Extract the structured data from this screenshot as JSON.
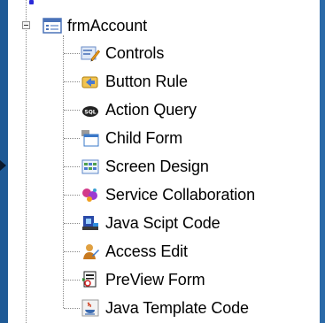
{
  "tree": {
    "root": {
      "label": "frmAccount",
      "icon": "form-window-icon"
    },
    "children": [
      {
        "label": "Controls",
        "icon": "controls-icon"
      },
      {
        "label": "Button Rule",
        "icon": "button-rule-icon"
      },
      {
        "label": "Action Query",
        "icon": "sql-query-icon"
      },
      {
        "label": "Child Form",
        "icon": "child-form-icon"
      },
      {
        "label": "Screen Design",
        "icon": "screen-design-icon"
      },
      {
        "label": "Service Collaboration",
        "icon": "service-collaboration-icon"
      },
      {
        "label": "Java Scipt Code",
        "icon": "javascript-code-icon"
      },
      {
        "label": "Access Edit",
        "icon": "access-edit-icon"
      },
      {
        "label": "PreView Form",
        "icon": "preview-form-icon"
      },
      {
        "label": "Java Template Code",
        "icon": "java-template-icon"
      }
    ]
  },
  "colors": {
    "background": "#1f5a96",
    "panel": "#ffffff"
  }
}
